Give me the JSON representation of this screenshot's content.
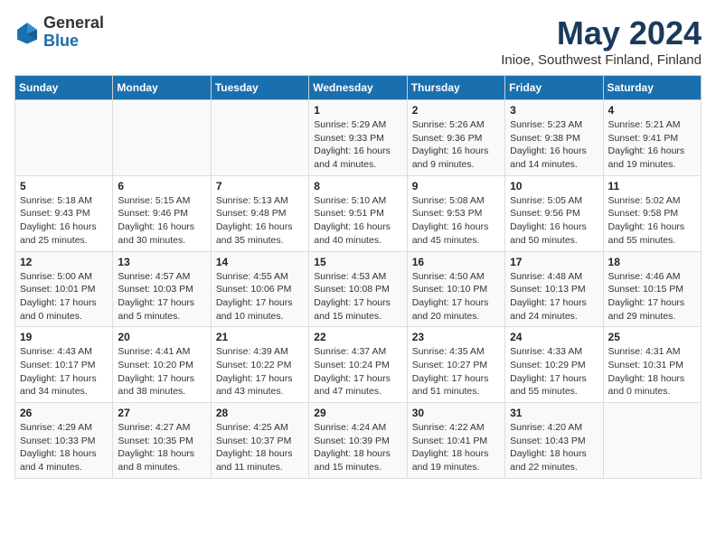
{
  "logo": {
    "general": "General",
    "blue": "Blue"
  },
  "title": "May 2024",
  "subtitle": "Inioe, Southwest Finland, Finland",
  "days_header": [
    "Sunday",
    "Monday",
    "Tuesday",
    "Wednesday",
    "Thursday",
    "Friday",
    "Saturday"
  ],
  "weeks": [
    [
      {
        "day": "",
        "info": ""
      },
      {
        "day": "",
        "info": ""
      },
      {
        "day": "",
        "info": ""
      },
      {
        "day": "1",
        "info": "Sunrise: 5:29 AM\nSunset: 9:33 PM\nDaylight: 16 hours\nand 4 minutes."
      },
      {
        "day": "2",
        "info": "Sunrise: 5:26 AM\nSunset: 9:36 PM\nDaylight: 16 hours\nand 9 minutes."
      },
      {
        "day": "3",
        "info": "Sunrise: 5:23 AM\nSunset: 9:38 PM\nDaylight: 16 hours\nand 14 minutes."
      },
      {
        "day": "4",
        "info": "Sunrise: 5:21 AM\nSunset: 9:41 PM\nDaylight: 16 hours\nand 19 minutes."
      }
    ],
    [
      {
        "day": "5",
        "info": "Sunrise: 5:18 AM\nSunset: 9:43 PM\nDaylight: 16 hours\nand 25 minutes."
      },
      {
        "day": "6",
        "info": "Sunrise: 5:15 AM\nSunset: 9:46 PM\nDaylight: 16 hours\nand 30 minutes."
      },
      {
        "day": "7",
        "info": "Sunrise: 5:13 AM\nSunset: 9:48 PM\nDaylight: 16 hours\nand 35 minutes."
      },
      {
        "day": "8",
        "info": "Sunrise: 5:10 AM\nSunset: 9:51 PM\nDaylight: 16 hours\nand 40 minutes."
      },
      {
        "day": "9",
        "info": "Sunrise: 5:08 AM\nSunset: 9:53 PM\nDaylight: 16 hours\nand 45 minutes."
      },
      {
        "day": "10",
        "info": "Sunrise: 5:05 AM\nSunset: 9:56 PM\nDaylight: 16 hours\nand 50 minutes."
      },
      {
        "day": "11",
        "info": "Sunrise: 5:02 AM\nSunset: 9:58 PM\nDaylight: 16 hours\nand 55 minutes."
      }
    ],
    [
      {
        "day": "12",
        "info": "Sunrise: 5:00 AM\nSunset: 10:01 PM\nDaylight: 17 hours\nand 0 minutes."
      },
      {
        "day": "13",
        "info": "Sunrise: 4:57 AM\nSunset: 10:03 PM\nDaylight: 17 hours\nand 5 minutes."
      },
      {
        "day": "14",
        "info": "Sunrise: 4:55 AM\nSunset: 10:06 PM\nDaylight: 17 hours\nand 10 minutes."
      },
      {
        "day": "15",
        "info": "Sunrise: 4:53 AM\nSunset: 10:08 PM\nDaylight: 17 hours\nand 15 minutes."
      },
      {
        "day": "16",
        "info": "Sunrise: 4:50 AM\nSunset: 10:10 PM\nDaylight: 17 hours\nand 20 minutes."
      },
      {
        "day": "17",
        "info": "Sunrise: 4:48 AM\nSunset: 10:13 PM\nDaylight: 17 hours\nand 24 minutes."
      },
      {
        "day": "18",
        "info": "Sunrise: 4:46 AM\nSunset: 10:15 PM\nDaylight: 17 hours\nand 29 minutes."
      }
    ],
    [
      {
        "day": "19",
        "info": "Sunrise: 4:43 AM\nSunset: 10:17 PM\nDaylight: 17 hours\nand 34 minutes."
      },
      {
        "day": "20",
        "info": "Sunrise: 4:41 AM\nSunset: 10:20 PM\nDaylight: 17 hours\nand 38 minutes."
      },
      {
        "day": "21",
        "info": "Sunrise: 4:39 AM\nSunset: 10:22 PM\nDaylight: 17 hours\nand 43 minutes."
      },
      {
        "day": "22",
        "info": "Sunrise: 4:37 AM\nSunset: 10:24 PM\nDaylight: 17 hours\nand 47 minutes."
      },
      {
        "day": "23",
        "info": "Sunrise: 4:35 AM\nSunset: 10:27 PM\nDaylight: 17 hours\nand 51 minutes."
      },
      {
        "day": "24",
        "info": "Sunrise: 4:33 AM\nSunset: 10:29 PM\nDaylight: 17 hours\nand 55 minutes."
      },
      {
        "day": "25",
        "info": "Sunrise: 4:31 AM\nSunset: 10:31 PM\nDaylight: 18 hours\nand 0 minutes."
      }
    ],
    [
      {
        "day": "26",
        "info": "Sunrise: 4:29 AM\nSunset: 10:33 PM\nDaylight: 18 hours\nand 4 minutes."
      },
      {
        "day": "27",
        "info": "Sunrise: 4:27 AM\nSunset: 10:35 PM\nDaylight: 18 hours\nand 8 minutes."
      },
      {
        "day": "28",
        "info": "Sunrise: 4:25 AM\nSunset: 10:37 PM\nDaylight: 18 hours\nand 11 minutes."
      },
      {
        "day": "29",
        "info": "Sunrise: 4:24 AM\nSunset: 10:39 PM\nDaylight: 18 hours\nand 15 minutes."
      },
      {
        "day": "30",
        "info": "Sunrise: 4:22 AM\nSunset: 10:41 PM\nDaylight: 18 hours\nand 19 minutes."
      },
      {
        "day": "31",
        "info": "Sunrise: 4:20 AM\nSunset: 10:43 PM\nDaylight: 18 hours\nand 22 minutes."
      },
      {
        "day": "",
        "info": ""
      }
    ]
  ]
}
